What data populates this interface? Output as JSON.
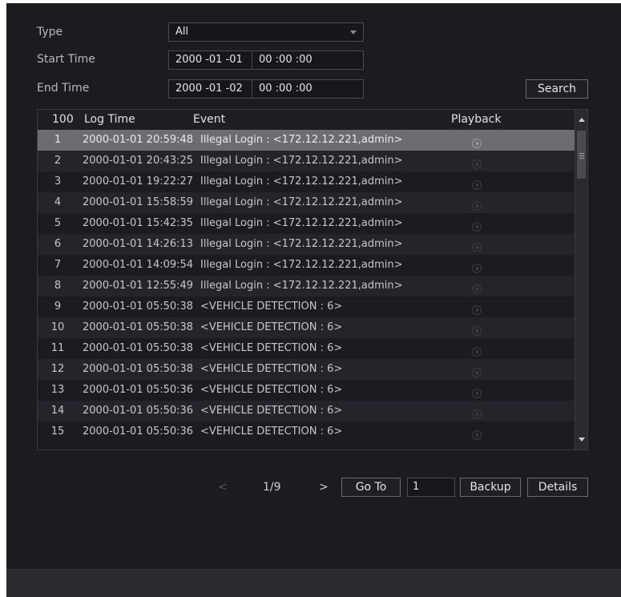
{
  "filters": {
    "type_label": "Type",
    "type_value": "All",
    "start_label": "Start Time",
    "start_date": "2000 -01 -01",
    "start_time": "00 :00 :00",
    "end_label": "End Time",
    "end_date": "2000 -01 -02",
    "end_time": "00 :00 :00",
    "search_label": "Search"
  },
  "table": {
    "headers": {
      "count": "100",
      "log_time": "Log Time",
      "event": "Event",
      "playback": "Playback"
    },
    "rows": [
      {
        "no": "1",
        "time": "2000-01-01 20:59:48",
        "event": "Illegal Login : <172.12.12.221,admin>"
      },
      {
        "no": "2",
        "time": "2000-01-01 20:43:25",
        "event": "Illegal Login : <172.12.12.221,admin>"
      },
      {
        "no": "3",
        "time": "2000-01-01 19:22:27",
        "event": "Illegal Login : <172.12.12.221,admin>"
      },
      {
        "no": "4",
        "time": "2000-01-01 15:58:59",
        "event": "Illegal Login : <172.12.12.221,admin>"
      },
      {
        "no": "5",
        "time": "2000-01-01 15:42:35",
        "event": "Illegal Login : <172.12.12.221,admin>"
      },
      {
        "no": "6",
        "time": "2000-01-01 14:26:13",
        "event": "Illegal Login : <172.12.12.221,admin>"
      },
      {
        "no": "7",
        "time": "2000-01-01 14:09:54",
        "event": "Illegal Login : <172.12.12.221,admin>"
      },
      {
        "no": "8",
        "time": "2000-01-01 12:55:49",
        "event": "Illegal Login : <172.12.12.221,admin>"
      },
      {
        "no": "9",
        "time": "2000-01-01 05:50:38",
        "event": "<VEHICLE DETECTION : 6>"
      },
      {
        "no": "10",
        "time": "2000-01-01 05:50:38",
        "event": "<VEHICLE DETECTION : 6>"
      },
      {
        "no": "11",
        "time": "2000-01-01 05:50:38",
        "event": "<VEHICLE DETECTION : 6>"
      },
      {
        "no": "12",
        "time": "2000-01-01 05:50:38",
        "event": "<VEHICLE DETECTION : 6>"
      },
      {
        "no": "13",
        "time": "2000-01-01 05:50:36",
        "event": "<VEHICLE DETECTION : 6>"
      },
      {
        "no": "14",
        "time": "2000-01-01 05:50:36",
        "event": "<VEHICLE DETECTION : 6>"
      },
      {
        "no": "15",
        "time": "2000-01-01 05:50:36",
        "event": "<VEHICLE DETECTION : 6>"
      }
    ],
    "selected_row": 1
  },
  "pagination": {
    "prev": "<",
    "page_indicator": "1/9",
    "next": ">",
    "goto_label": "Go To",
    "goto_value": "1",
    "backup_label": "Backup",
    "details_label": "Details"
  },
  "icons": {
    "dropdown": "chevron-down-icon",
    "playback": "play-circle-icon",
    "scroll_up": "arrow-up-icon",
    "scroll_down": "arrow-down-icon"
  },
  "colors": {
    "background": "#1b1c20",
    "selected_row": "#6c6d72",
    "alt_row": "#24252a",
    "border": "#4b4c52"
  }
}
